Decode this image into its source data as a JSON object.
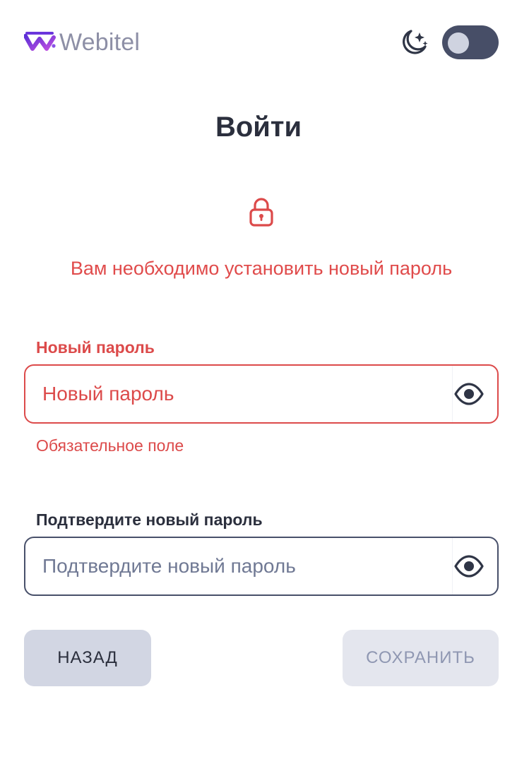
{
  "header": {
    "logo_text": "Webitel",
    "theme_toggle_on": true
  },
  "title": "Войти",
  "alert_message": "Вам необходимо установить новый пароль",
  "new_password": {
    "label": "Новый пароль",
    "placeholder": "Новый пароль",
    "value": "",
    "error": "Обязательное поле"
  },
  "confirm_password": {
    "label": "Подтвердите новый пароль",
    "placeholder": "Подтвердите новый пароль",
    "value": ""
  },
  "buttons": {
    "back_label": "НАЗАД",
    "save_label": "СОХРАНИТЬ"
  },
  "colors": {
    "error": "#dc4a4a",
    "text_dark": "#2b2f3d",
    "logo_purple": "#7b3fe4",
    "toggle_bg": "#474e67"
  },
  "icons": {
    "logo": "webitel-logo-icon",
    "theme": "moon-stars-icon",
    "lock": "lock-icon",
    "eye": "eye-icon"
  }
}
